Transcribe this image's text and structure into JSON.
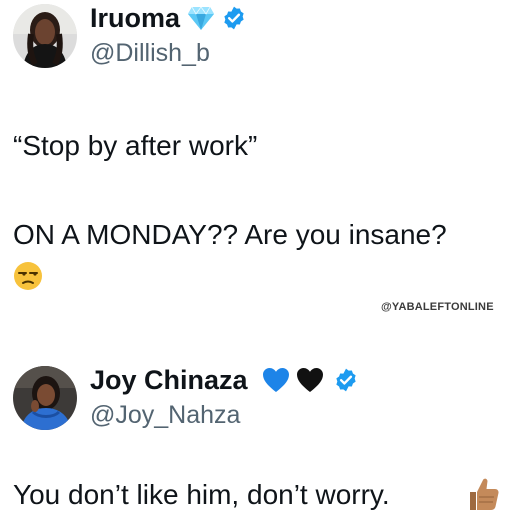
{
  "post1": {
    "display_name": "Iruoma",
    "handle": "@Dillish_b",
    "name_icons": [
      "gem-icon",
      "verified-badge-icon"
    ],
    "quote_line": "“Stop by after work”",
    "text_line": "ON A MONDAY?? Are you insane?",
    "emoji": "unamused-face-icon"
  },
  "watermark": "@YABALEFTONLINE",
  "post2": {
    "display_name": "Joy Chinaza",
    "handle": "@Joy_Nahza",
    "name_icons": [
      "blue-heart-icon",
      "black-heart-icon",
      "verified-badge-icon"
    ],
    "text_line": "You don’t like him, don’t worry.",
    "emoji": "thumbs-up-icon"
  },
  "colors": {
    "verified": "#1d9bf0",
    "handle": "#536471",
    "text": "#0f1419",
    "blue_heart": "#1d84e8",
    "black_heart": "#111111",
    "gem": "#5bc8f5",
    "emoji_yellow": "#f7c23c",
    "thumb_skin": "#c48a5a"
  }
}
